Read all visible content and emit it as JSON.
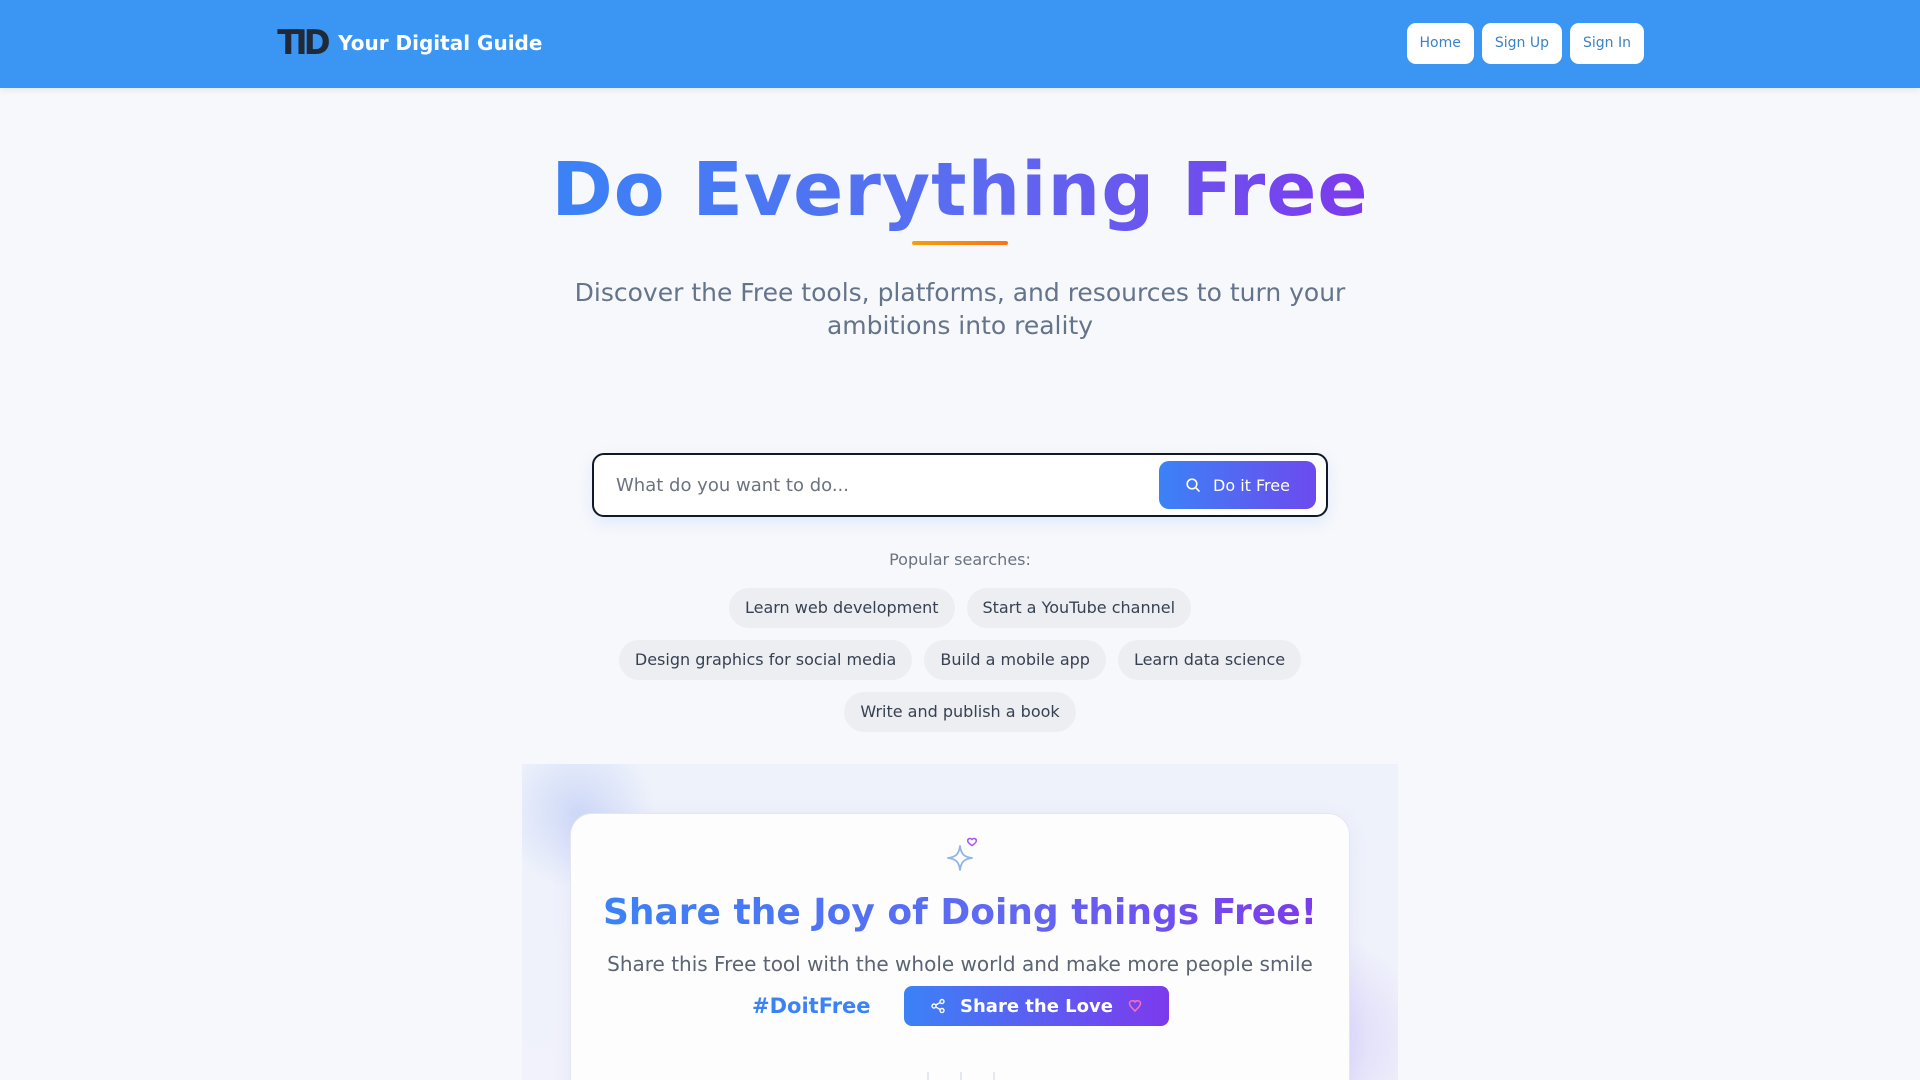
{
  "header": {
    "logo_text": "TID",
    "brand_name": "Your Digital Guide",
    "nav": [
      {
        "label": "Home"
      },
      {
        "label": "Sign Up"
      },
      {
        "label": "Sign In"
      }
    ]
  },
  "hero": {
    "title": "Do Everything Free",
    "subtitle": "Discover the Free tools, platforms, and resources to turn your ambitions into reality"
  },
  "search": {
    "placeholder": "What do you want to do...",
    "value": "",
    "button_label": "Do it Free",
    "button_icon": "search-icon"
  },
  "popular": {
    "label": "Popular searches:",
    "rows": [
      [
        "Learn web development",
        "Start a YouTube channel"
      ],
      [
        "Design graphics for social media",
        "Build a mobile app",
        "Learn data science"
      ],
      [
        "Write and publish a book"
      ]
    ]
  },
  "share": {
    "icon": "sparkle-heart-icon",
    "title": "Share the Joy of Doing things Free!",
    "subtitle": "Share this Free tool with the whole world and make more people smile",
    "hashtag": "#DoitFree",
    "button_label": "Share the Love",
    "button_icon_left": "share-icon",
    "button_icon_right": "heart-icon"
  },
  "colors": {
    "header_bg": "#3b96f3",
    "accent_blue": "#3b82f6",
    "accent_purple": "#7c3aed",
    "underline_orange": "#f59e0b"
  }
}
